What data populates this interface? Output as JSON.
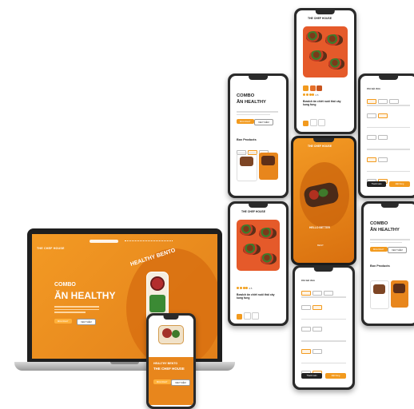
{
  "brand": {
    "logo": "THE CHEF HOUSE",
    "accent": "#e8861c",
    "accent_light": "#f29a1e",
    "dark": "#2a2a2a"
  },
  "laptop": {
    "nav_logo": "THE CHEF HOUSE",
    "hero_line1": "COMBO",
    "hero_line2": "ĂN HEALTHY",
    "primary_button": "MUA NGAY",
    "secondary_button": "XEM THÊM",
    "arc_text": "HEALTHY BENTO"
  },
  "phone_front": {
    "logo": "THE CHEF HOUSE",
    "tagline": "HEALTHY BENTO",
    "primary_button": "MUA NGAY",
    "secondary_button": "XEM THÊM"
  },
  "phone_combo": {
    "logo": "THE CHEF HOUSE",
    "title_line1": "COMBO",
    "title_line2": "ĂN HEALTHY",
    "primary_button": "MUA NGAY",
    "secondary_button": "XEM THÊM",
    "section": "Box Products"
  },
  "phone_product": {
    "logo": "THE CHEF HOUSE",
    "rating": "4.5",
    "title": "Bowlch ăn chiết nuôi thái cây kung fung"
  },
  "phone_splash": {
    "logo": "THE CHEF HOUSE",
    "tagline": "HELLO BETTER",
    "sub": "BEST"
  },
  "phone_order": {
    "header": "Chi tiết đơn",
    "footer_dark": "Thanh toán",
    "footer_orange": "Đặt hàng"
  }
}
